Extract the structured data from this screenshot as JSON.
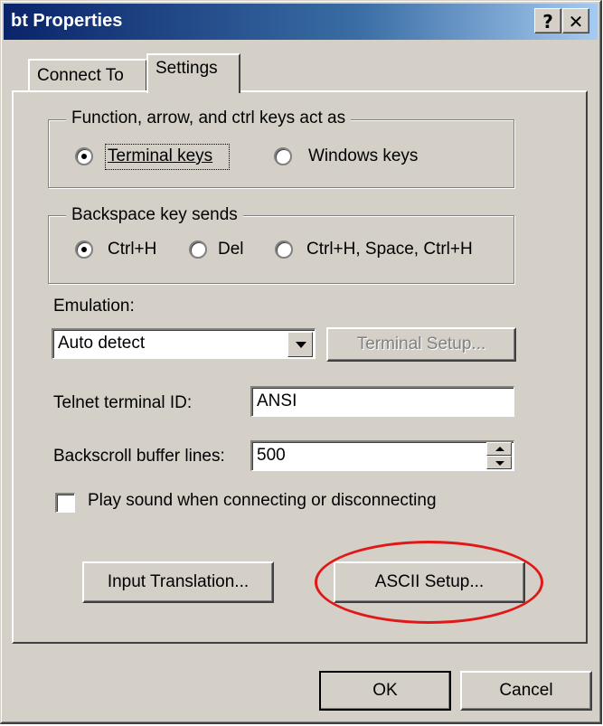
{
  "window": {
    "title": "bt Properties",
    "help_glyph": "?",
    "close_glyph": "✕"
  },
  "tabs": [
    {
      "label": "Connect To",
      "selected": false
    },
    {
      "label": "Settings",
      "selected": true
    }
  ],
  "keys_group": {
    "legend": "Function, arrow, and ctrl keys act as",
    "options": [
      {
        "label": "Terminal keys",
        "selected": true
      },
      {
        "label": "Windows keys",
        "selected": false
      }
    ]
  },
  "backspace_group": {
    "legend": "Backspace key sends",
    "options": [
      {
        "label": "Ctrl+H",
        "selected": true
      },
      {
        "label": "Del",
        "selected": false
      },
      {
        "label": "Ctrl+H, Space, Ctrl+H",
        "selected": false
      }
    ]
  },
  "emulation": {
    "label": "Emulation:",
    "value": "Auto detect",
    "terminal_setup_label": "Terminal Setup..."
  },
  "telnet": {
    "label": "Telnet terminal ID:",
    "value": "ANSI"
  },
  "backscroll": {
    "label": "Backscroll buffer lines:",
    "value": "500"
  },
  "play_sound": {
    "label": "Play sound when connecting or disconnecting",
    "checked": false
  },
  "buttons": {
    "input_translation": "Input Translation...",
    "ascii_setup": "ASCII Setup...",
    "ok": "OK",
    "cancel": "Cancel"
  },
  "annotation": {
    "color": "#e01818"
  },
  "colors": {
    "titlebar": "#0a246a",
    "face": "#d4d0c8"
  }
}
